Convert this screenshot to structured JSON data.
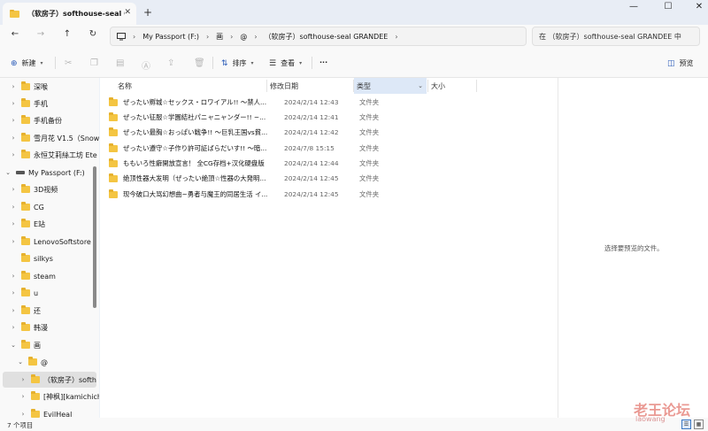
{
  "window": {
    "tab_title": "（软房子）softhouse-seal GRANDEE",
    "tab_close": "✕",
    "new_tab": "+",
    "minimize": "—",
    "maximize": "☐",
    "close": "✕"
  },
  "nav": {
    "back": "←",
    "forward": "→",
    "up": "↑",
    "refresh": "↻"
  },
  "address": {
    "segments": [
      "My Passport (F:)",
      "画",
      "@",
      "（软房子）softhouse-seal GRANDEE"
    ],
    "separator": "›",
    "search_placeholder": "在 （软房子）softhouse-seal GRANDEE 中"
  },
  "commands": {
    "new": "新建",
    "sort": "排序",
    "view": "查看",
    "more": "···",
    "preview": "预览"
  },
  "tree": [
    {
      "label": "深喉",
      "indent": 1
    },
    {
      "label": "手机",
      "indent": 1
    },
    {
      "label": "手机备份",
      "indent": 1
    },
    {
      "label": "雪月花 V1.5（Snow",
      "indent": 1
    },
    {
      "label": "永恒艾莉絲工坊 Ete",
      "indent": 1
    },
    {
      "label": "My Passport (F:)",
      "indent": 0,
      "drive": true
    },
    {
      "label": "3D视频",
      "indent": 1
    },
    {
      "label": "CG",
      "indent": 1
    },
    {
      "label": "E站",
      "indent": 1
    },
    {
      "label": "LenovoSoftstore",
      "indent": 1
    },
    {
      "label": "silkys",
      "indent": 1
    },
    {
      "label": "steam",
      "indent": 1
    },
    {
      "label": "u",
      "indent": 1
    },
    {
      "label": "还",
      "indent": 1
    },
    {
      "label": "韩漫",
      "indent": 1
    },
    {
      "label": "画",
      "indent": 1,
      "expanded": true
    },
    {
      "label": "@",
      "indent": 2,
      "expanded": true
    },
    {
      "label": "（软房子）softh",
      "indent": 3,
      "selected": true
    },
    {
      "label": "[神枫][kamichich",
      "indent": 3
    },
    {
      "label": "EvilHeal",
      "indent": 3
    }
  ],
  "columns": {
    "name": "名称",
    "date": "修改日期",
    "type": "类型",
    "size": "大小"
  },
  "files": [
    {
      "name": "ぜったい孵城☆セックス・ロワイアル!! ～禁人...",
      "date": "2024/2/14 12:43",
      "type": "文件夹"
    },
    {
      "name": "ぜったい征服☆学園結社パニャニャンダー!! ~...",
      "date": "2024/2/14 12:41",
      "type": "文件夹"
    },
    {
      "name": "ぜったい最胸☆おっぱい戦争!! ～巨乳王国vs貧...",
      "date": "2024/2/14 12:42",
      "type": "文件夹"
    },
    {
      "name": "ぜったい遵守☆子作り許可証ばらだいす!! ～暗...",
      "date": "2024/7/8 15:15",
      "type": "文件夹"
    },
    {
      "name": "ももいろ性癖開放宣言！ 全CG存档+汉化硬盘版",
      "date": "2024/2/14 12:44",
      "type": "文件夹"
    },
    {
      "name": "绝顶性器大发明（ぜったい絶頂☆性器の大発明...",
      "date": "2024/2/14 12:45",
      "type": "文件夹"
    },
    {
      "name": "现今破口大骂幻想曲~勇者与魔王的同居生活 イ...",
      "date": "2024/2/14 12:45",
      "type": "文件夹"
    }
  ],
  "preview": {
    "empty_text": "选择要预览的文件。"
  },
  "status": {
    "item_count": "7 个项目"
  },
  "watermark": {
    "title": "老王论坛",
    "site": "laowang"
  }
}
